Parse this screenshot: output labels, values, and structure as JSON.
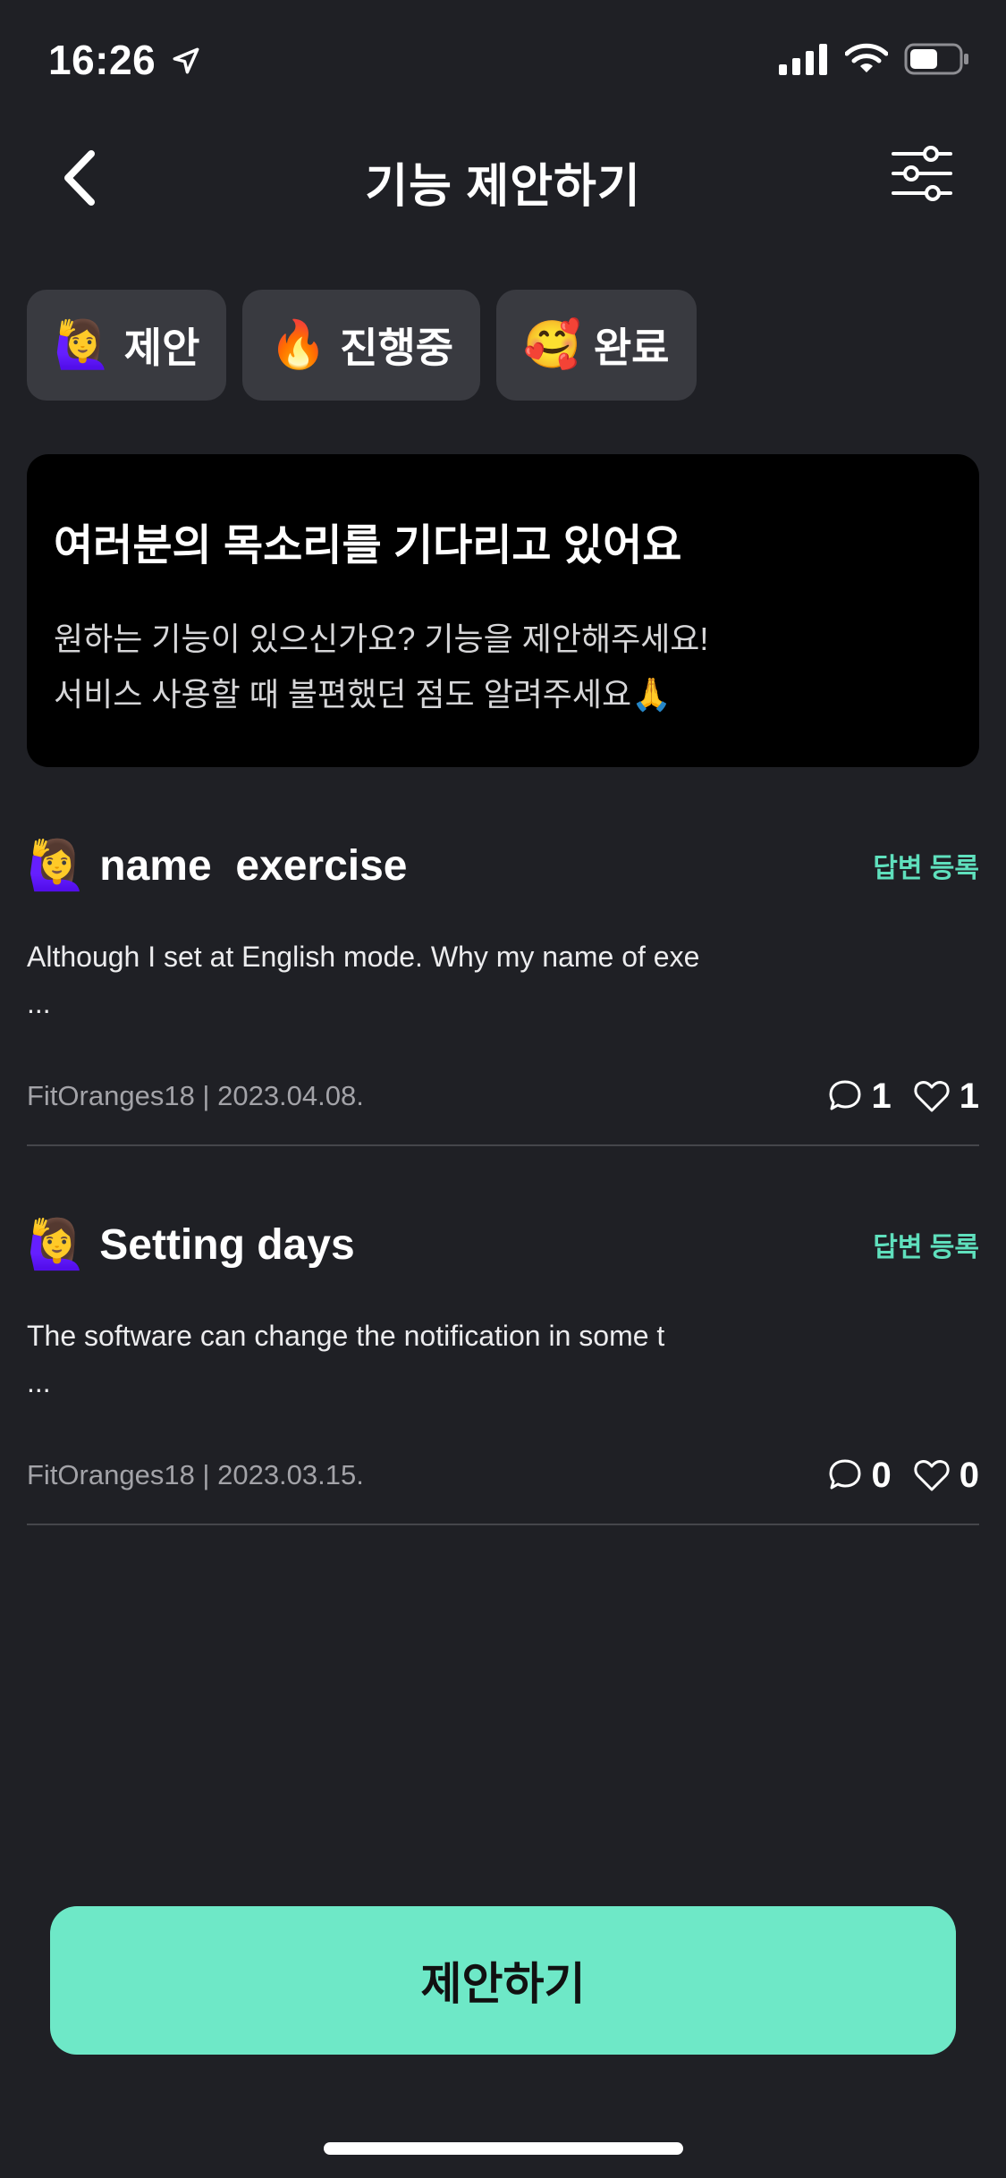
{
  "status": {
    "time": "16:26"
  },
  "nav": {
    "title": "기능 제안하기"
  },
  "chips": [
    {
      "emoji": "🙋‍♀️",
      "label": "제안"
    },
    {
      "emoji": "🔥",
      "label": "진행중"
    },
    {
      "emoji": "🥰",
      "label": "완료"
    }
  ],
  "banner": {
    "title": "여러분의 목소리를 기다리고 있어요",
    "line1": "원하는 기능이 있으신가요? 기능을 제안해주세요!",
    "line2": "서비스 사용할 때 불편했던 점도 알려주세요🙏"
  },
  "posts": [
    {
      "emoji": "🙋‍♀️",
      "title": "name  exercise",
      "answer_label": "답변 등록",
      "body": "Although I set at English mode. Why my name of exe",
      "ellipsis": "...",
      "author_date": "FitOranges18 | 2023.04.08.",
      "comments": "1",
      "likes": "1"
    },
    {
      "emoji": "🙋‍♀️",
      "title": "Setting days",
      "answer_label": "답변 등록",
      "body": "The software can change the notification in some t",
      "ellipsis": "...",
      "author_date": "FitOranges18 | 2023.03.15.",
      "comments": "0",
      "likes": "0"
    }
  ],
  "cta": {
    "label": "제안하기"
  },
  "colors": {
    "background": "#1f2025",
    "chip": "#393a40",
    "accent": "#6ee8c7",
    "answer_tag": "#5fe0bd"
  }
}
